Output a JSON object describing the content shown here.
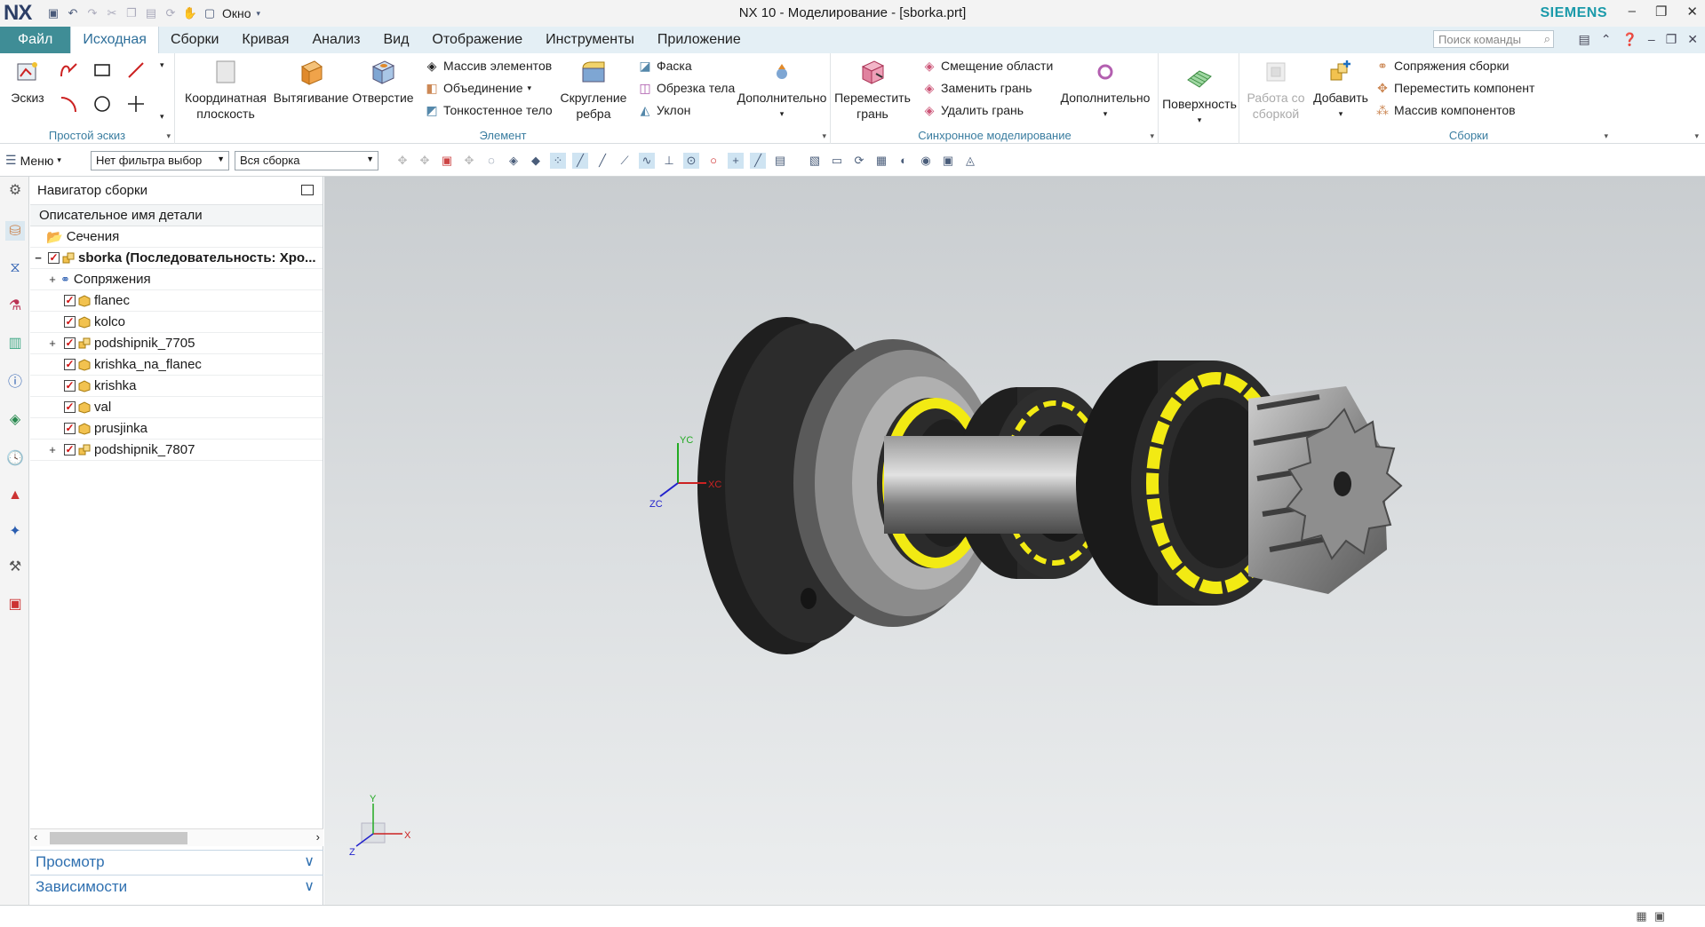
{
  "titlebar": {
    "logo": "NX",
    "window_menu": "Окно",
    "title": "NX 10 - Моделирование - [sborka.prt]",
    "brand": "SIEMENS"
  },
  "tabs": [
    {
      "label": "Файл"
    },
    {
      "label": "Исходная"
    },
    {
      "label": "Сборки"
    },
    {
      "label": "Кривая"
    },
    {
      "label": "Анализ"
    },
    {
      "label": "Вид"
    },
    {
      "label": "Отображение"
    },
    {
      "label": "Инструменты"
    },
    {
      "label": "Приложение"
    }
  ],
  "command_search": {
    "placeholder": "Поиск команды"
  },
  "ribbon": {
    "sketch_group": {
      "label": "Простой эскиз",
      "sketch_button": "Эскиз"
    },
    "element_group": {
      "label": "Элемент",
      "datum_plane": "Координатная плоскость",
      "extrude": "Вытягивание",
      "hole": "Отверстие",
      "pattern_feature": "Массив элементов",
      "unite": "Объединение",
      "thicken": "Тонкостенное тело",
      "edge_blend": "Скругление ребра",
      "chamfer": "Фаска",
      "trim_body": "Обрезка тела",
      "draft": "Уклон",
      "more": "Дополнительно"
    },
    "sync_group": {
      "label": "Синхронное моделирование",
      "move_face": "Переместить грань",
      "offset_region": "Смещение области",
      "replace_face": "Заменить грань",
      "delete_face": "Удалить грань",
      "more": "Дополнительно"
    },
    "surface_group": {
      "surface": "Поверхность"
    },
    "assembly_group": {
      "label": "Сборки",
      "work_with_assembly": "Работа со сборкой",
      "add": "Добавить",
      "assembly_constraints": "Сопряжения сборки",
      "move_component": "Переместить компонент",
      "pattern_component": "Массив компонентов"
    }
  },
  "toolbar": {
    "menu_label": "Меню",
    "filter_value": "Нет фильтра выбор",
    "scope_value": "Вся сборка"
  },
  "navigator": {
    "title": "Навигатор сборки",
    "column_header": "Описательное имя детали",
    "rows": [
      {
        "label": "Сечения"
      },
      {
        "label": "sborka (Последовательность: Хро..."
      },
      {
        "label": "Сопряжения"
      },
      {
        "label": "flanec"
      },
      {
        "label": "kolco"
      },
      {
        "label": "podshipnik_7705"
      },
      {
        "label": "krishka_na_flanec"
      },
      {
        "label": "krishka"
      },
      {
        "label": "val"
      },
      {
        "label": "prusjinka"
      },
      {
        "label": "podshipnik_7807"
      }
    ],
    "preview_section": "Просмотр",
    "dependencies_section": "Зависимости"
  },
  "viewport": {
    "triad_labels": {
      "x": "X",
      "y": "Y",
      "z": "Z"
    },
    "wcs_labels": {
      "x": "XC",
      "y": "YC",
      "z": "ZC"
    }
  },
  "colors": {
    "file_tab": "#3f8d96",
    "accent_blue": "#3a7da0",
    "brand_teal": "#1b9aaa",
    "model_dark": "#2a2a2a",
    "cage_yellow": "#f2ea13"
  }
}
